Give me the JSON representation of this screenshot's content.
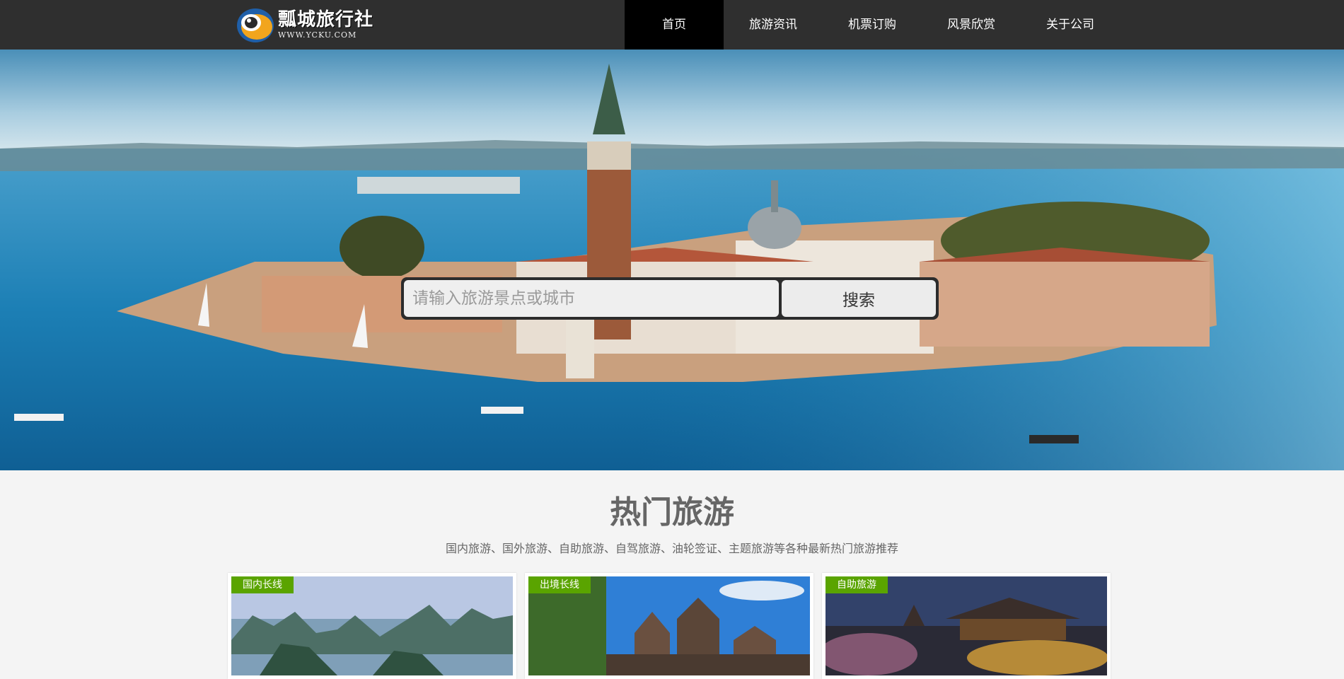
{
  "header": {
    "logo_name": "瓢城旅行社",
    "logo_url": "WWW.YCKU.COM",
    "nav": [
      {
        "label": "首页",
        "active": true
      },
      {
        "label": "旅游资讯",
        "active": false
      },
      {
        "label": "机票订购",
        "active": false
      },
      {
        "label": "风景欣赏",
        "active": false
      },
      {
        "label": "关于公司",
        "active": false
      }
    ]
  },
  "search": {
    "placeholder": "请输入旅游景点或城市",
    "button_label": "搜索"
  },
  "section": {
    "title": "热门旅游",
    "subtitle": "国内旅游、国外旅游、自助旅游、自驾旅游、油轮签证、主题旅游等各种最新热门旅游推荐"
  },
  "cards": [
    {
      "tag": "国内长线"
    },
    {
      "tag": "出境长线"
    },
    {
      "tag": "自助旅游"
    }
  ],
  "colors": {
    "header_bg": "#2f2f2f",
    "nav_active_bg": "#000000",
    "tag_green": "#5aa400",
    "page_bg": "#f4f4f4"
  }
}
